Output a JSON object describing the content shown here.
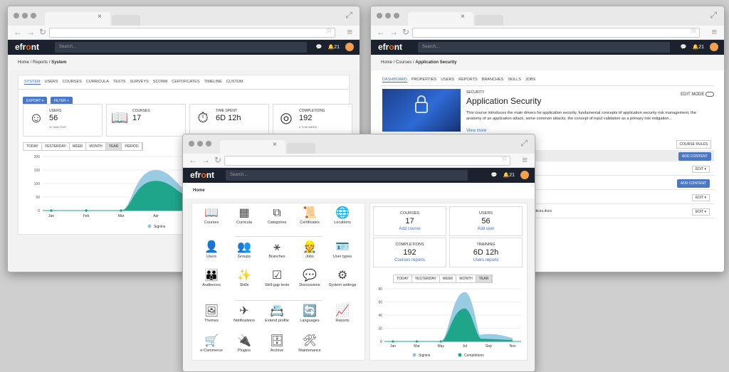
{
  "left": {
    "logo_a": "efr",
    "logo_b": "o",
    "logo_c": "nt",
    "search_placeholder": "Search...",
    "notif_count": "21",
    "breadcrumb": {
      "home": "Home",
      "sep1": "/",
      "reports": "Reports",
      "sep2": "/",
      "current": "System"
    },
    "tabs": [
      "SYSTEM",
      "USERS",
      "COURSES",
      "CURRICULA",
      "TESTS",
      "SURVEYS",
      "SCORM",
      "CERTIFICATES",
      "TIMELINE",
      "CUSTOM"
    ],
    "export_label": "EXPORT",
    "filter_label": "FILTER",
    "kpis": [
      {
        "label": "USERS",
        "value": "56",
        "sub": "12 INACTIVE",
        "icon": "user-icon"
      },
      {
        "label": "COURSES",
        "value": "17",
        "sub": "",
        "icon": "book-icon"
      },
      {
        "label": "TIME SPENT",
        "value": "6D 12h",
        "sub": "",
        "icon": "stopwatch-icon"
      },
      {
        "label": "COMPLETIONS",
        "value": "192",
        "sub": "0 THIS WEEK",
        "icon": "target-icon"
      }
    ],
    "periods": [
      "TODAY",
      "YESTERDAY",
      "WEEK",
      "MONTH",
      "YEAR",
      "PERIOD"
    ],
    "active_period": "YEAR",
    "yticks": [
      "200",
      "150",
      "100",
      "50",
      "0"
    ],
    "xticks": [
      "Jan",
      "Feb",
      "Mar",
      "Apr",
      "May"
    ],
    "legend": "Signins"
  },
  "right": {
    "search_placeholder": "Search...",
    "notif_count": "21",
    "breadcrumb": {
      "home": "Home",
      "sep1": "/",
      "courses": "Courses",
      "sep2": "/",
      "current": "Application Security"
    },
    "tabs": [
      "DASHBOARD",
      "PROPERTIES",
      "USERS",
      "REPORTS",
      "BRANCHES",
      "SKILLS",
      "JOBS"
    ],
    "category": "SECURITY",
    "title": "Application Security",
    "edit_mode": "EDIT MODE",
    "description": "This course introduces the main drivers for application security, fundamental concepts of application security risk management, the anatomy of an application attack, some common attacks, the concept of input validation as a primary risk mitigation...",
    "view_more": "View more",
    "course_rules": "COURSE RULES",
    "add_content": "ADD CONTENT",
    "rows": [
      {
        "text": "",
        "action": "EDIT"
      },
      {
        "text": "ent",
        "action": "ADD CONTENT"
      },
      {
        "text": "ocx",
        "action": "EDIT"
      },
      {
        "text": "est practices.docx",
        "action": "EDIT"
      }
    ]
  },
  "front": {
    "search_placeholder": "Search...",
    "notif_count": "21",
    "breadcrumb": "Home",
    "icons": [
      {
        "label": "Courses",
        "icon": "courses-icon",
        "g": "📖"
      },
      {
        "label": "Curricula",
        "icon": "curricula-icon",
        "g": "▦"
      },
      {
        "label": "Categories",
        "icon": "categories-icon",
        "g": "⧉"
      },
      {
        "label": "Certificates",
        "icon": "certificates-icon",
        "g": "📜"
      },
      {
        "label": "Locations",
        "icon": "locations-icon",
        "g": "🌐"
      },
      {
        "label": "Users",
        "icon": "users-icon",
        "g": "👤"
      },
      {
        "label": "Groups",
        "icon": "groups-icon",
        "g": "👥"
      },
      {
        "label": "Branches",
        "icon": "branches-icon",
        "g": "⚹"
      },
      {
        "label": "Jobs",
        "icon": "jobs-icon",
        "g": "👷"
      },
      {
        "label": "User types",
        "icon": "user-types-icon",
        "g": "🪪"
      },
      {
        "label": "Audiences",
        "icon": "audiences-icon",
        "g": "👪"
      },
      {
        "label": "Skills",
        "icon": "skills-icon",
        "g": "✨"
      },
      {
        "label": "Skill-gap tests",
        "icon": "skill-gap-tests-icon",
        "g": "☑"
      },
      {
        "label": "Discussions",
        "icon": "discussions-icon",
        "g": "💬"
      },
      {
        "label": "System settings",
        "icon": "system-settings-icon",
        "g": "⚙"
      },
      {
        "label": "Themes",
        "icon": "themes-icon",
        "g": "🖼"
      },
      {
        "label": "Notifications",
        "icon": "notifications-icon",
        "g": "✈"
      },
      {
        "label": "Extend profile",
        "icon": "extend-profile-icon",
        "g": "📇"
      },
      {
        "label": "Languages",
        "icon": "languages-icon",
        "g": "🔄"
      },
      {
        "label": "Reports",
        "icon": "reports-icon",
        "g": "📈"
      },
      {
        "label": "e-Commerce",
        "icon": "ecommerce-icon",
        "g": "🛒"
      },
      {
        "label": "Plugins",
        "icon": "plugins-icon",
        "g": "🔌"
      },
      {
        "label": "Archive",
        "icon": "archive-icon",
        "g": "🗄"
      },
      {
        "label": "Maintenance",
        "icon": "maintenance-icon",
        "g": "🛠"
      }
    ],
    "stats": [
      {
        "label": "COURSES",
        "value": "17",
        "action": "Add course"
      },
      {
        "label": "USERS",
        "value": "56",
        "action": "Add user"
      },
      {
        "label": "COMPLETIONS",
        "value": "192",
        "action": "Courses reports"
      },
      {
        "label": "TRAINING",
        "value": "6D 12h",
        "action": "Users reports"
      }
    ],
    "periods": [
      "TODAY",
      "YESTERDAY",
      "WEEK",
      "MONTH",
      "YEAR"
    ],
    "active_period": "YEAR",
    "yticks": [
      "80",
      "60",
      "40",
      "20",
      "0"
    ],
    "xticks": [
      "Jan",
      "Mar",
      "May",
      "Jul",
      "Sep",
      "Nov"
    ],
    "legend1": "Signins",
    "legend2": "Completions"
  },
  "colors": {
    "signins": "#8ec6e0",
    "completions": "#1fa58a",
    "accent": "#4a78c8",
    "appbar": "#1b222e",
    "logo_o": "#e86b2a"
  },
  "chart_data": [
    {
      "type": "area",
      "title": "",
      "series": [
        {
          "name": "Signins",
          "x": [
            "Jan",
            "Feb",
            "Mar",
            "Apr",
            "May"
          ],
          "values": [
            0,
            0,
            0,
            140,
            60
          ]
        }
      ],
      "ylim": [
        0,
        200
      ]
    },
    {
      "type": "area",
      "title": "",
      "series": [
        {
          "name": "Signins",
          "x": [
            "Jan",
            "Mar",
            "May",
            "Jul",
            "Sep",
            "Nov"
          ],
          "values": [
            0,
            0,
            0,
            75,
            12,
            5
          ]
        },
        {
          "name": "Completions",
          "x": [
            "Jan",
            "Mar",
            "May",
            "Jul",
            "Sep",
            "Nov"
          ],
          "values": [
            0,
            0,
            0,
            50,
            5,
            2
          ]
        }
      ],
      "ylim": [
        0,
        80
      ]
    }
  ]
}
